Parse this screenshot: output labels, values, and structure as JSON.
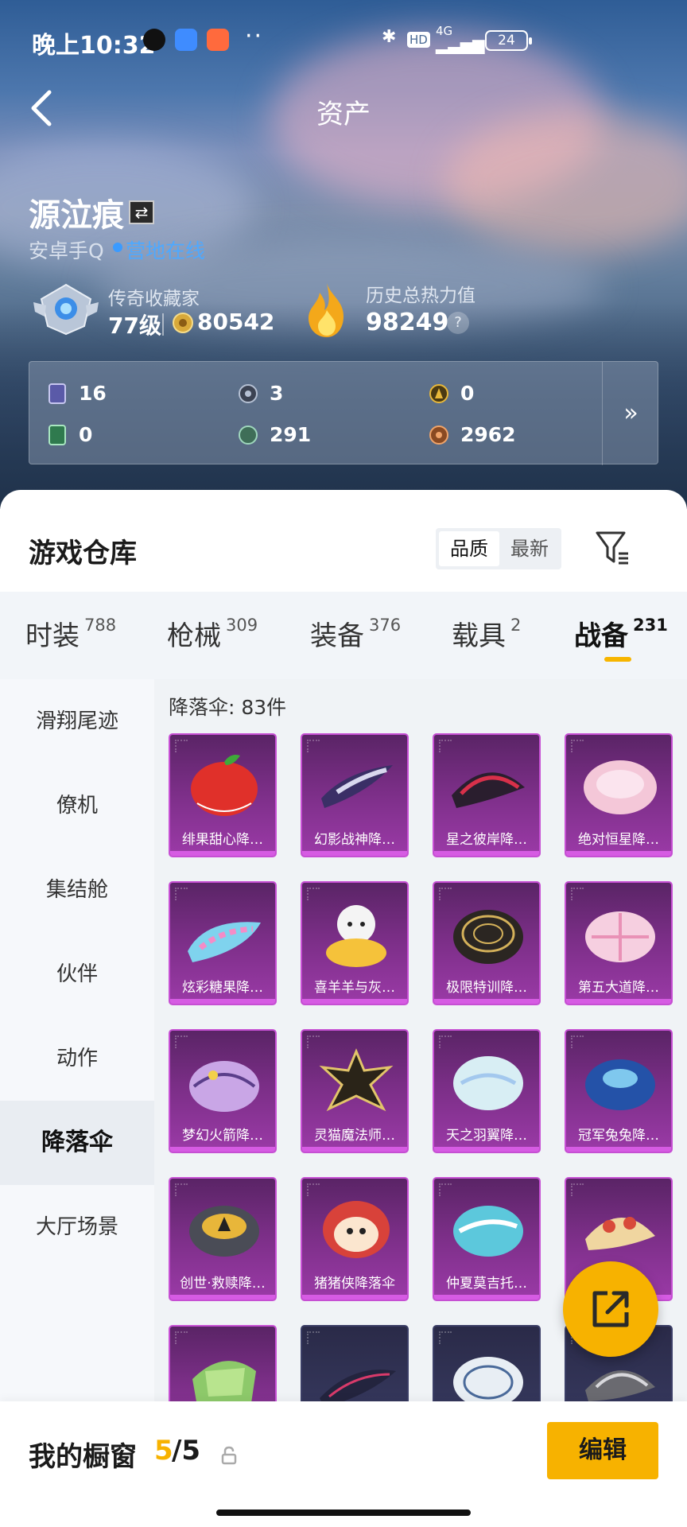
{
  "status_bar": {
    "time": "晚上10:32",
    "network": "4G",
    "hd": "HD",
    "battery": "24"
  },
  "header": {
    "title": "资产"
  },
  "profile": {
    "name": "源泣痕",
    "account": "安卓手Q",
    "online_status": "营地在线",
    "rank_title": "传奇收藏家",
    "level": "77级",
    "coins": "80542",
    "heat_label": "历史总热力值",
    "heat_value": "98249",
    "help": "?"
  },
  "currencies": [
    "16",
    "3",
    "0",
    "0",
    "291",
    "2962"
  ],
  "currency_more": "»",
  "warehouse": {
    "title": "游戏仓库",
    "sort_options": [
      "品质",
      "最新"
    ],
    "tabs": [
      {
        "label": "时装",
        "count": "788"
      },
      {
        "label": "枪械",
        "count": "309"
      },
      {
        "label": "装备",
        "count": "376"
      },
      {
        "label": "载具",
        "count": "2"
      },
      {
        "label": "战备",
        "count": "231"
      }
    ],
    "sidebar": [
      "滑翔尾迹",
      "僚机",
      "集结舱",
      "伙伴",
      "动作",
      "降落伞",
      "大厅场景"
    ],
    "active_sidebar": "降落伞",
    "grid_header": "降落伞: 83件",
    "items": [
      "绯果甜心降…",
      "幻影战神降…",
      "星之彼岸降…",
      "绝对恒星降…",
      "炫彩糖果降…",
      "喜羊羊与灰…",
      "极限特训降…",
      "第五大道降…",
      "梦幻火箭降…",
      "灵猫魔法师…",
      "天之羽翼降…",
      "冠军兔兔降…",
      "创世·救赎降…",
      "猪猪侠降落伞",
      "仲夏莫吉托…",
      ""
    ]
  },
  "showcase": {
    "title": "我的橱窗",
    "current": "5",
    "sep_total": "/5",
    "edit": "编辑"
  },
  "colors": {
    "accent": "#f7b200",
    "card_purple": "#9b3aa7",
    "online": "#4ea9ff"
  }
}
